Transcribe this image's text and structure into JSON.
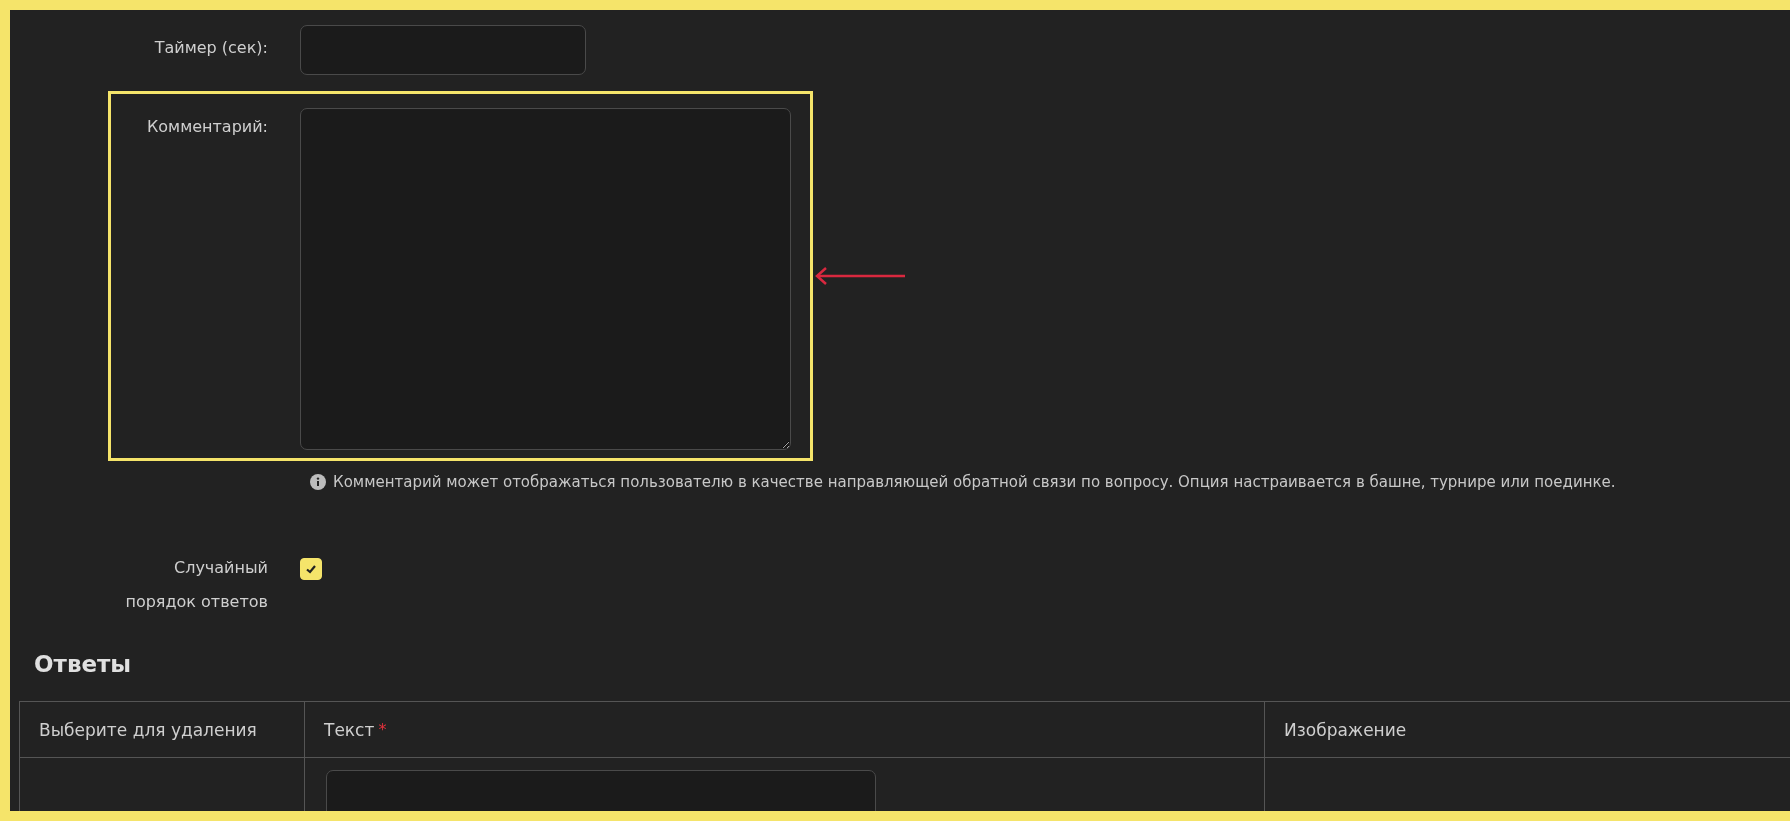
{
  "timer": {
    "label": "Таймер (сек):"
  },
  "comment": {
    "label": "Комментарий:",
    "highlighted": true,
    "help": "Комментарий может отображаться пользователю в качестве направляющей обратной связи по вопросу. Опция настраивается в башне, турнире или поединке."
  },
  "shuffle": {
    "label": "Случайный порядок ответов",
    "checked": true
  },
  "answers": {
    "title": "Ответы",
    "columns": [
      {
        "label": "Выберите для удаления"
      },
      {
        "label": "Текст",
        "required": "*"
      },
      {
        "label": "Изображение"
      }
    ]
  }
}
